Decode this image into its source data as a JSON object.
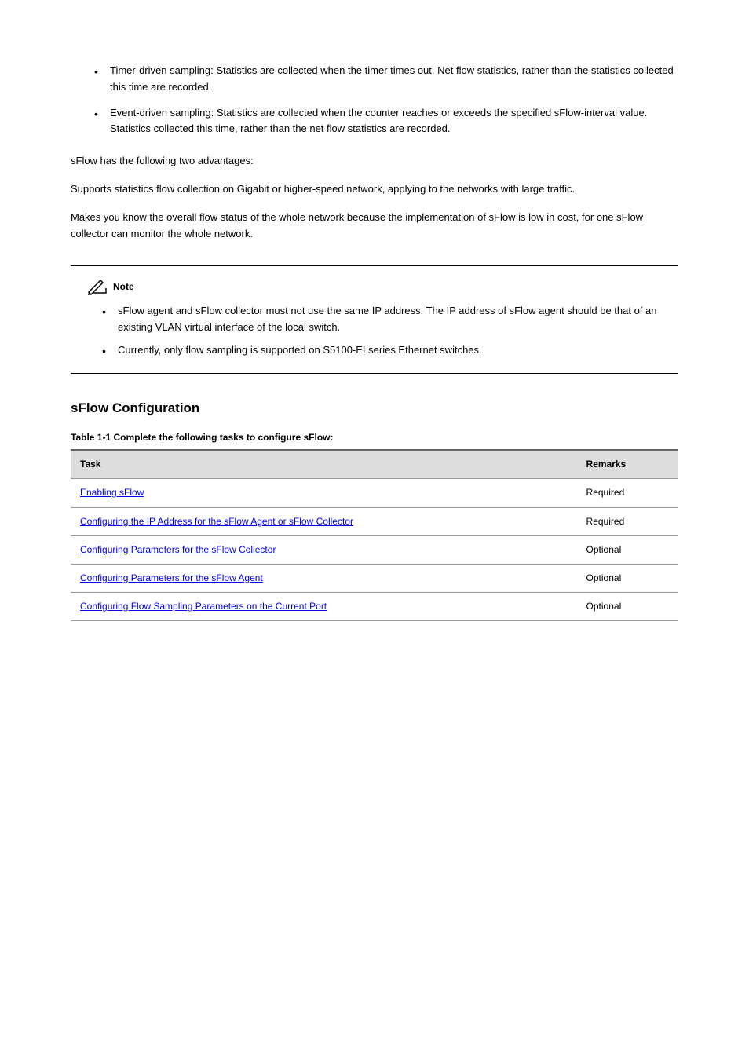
{
  "list1": {
    "item1": "Timer-driven sampling: Statistics are collected when the timer times out. Net flow statistics, rather than the statistics collected this time are recorded.",
    "item2": "Event-driven sampling: Statistics are collected when the counter reaches or exceeds the specified sFlow-interval value. Statistics collected this time, rather than the net flow statistics are recorded."
  },
  "para1": "sFlow has the following two advantages:",
  "para2": "Supports statistics flow collection on Gigabit or higher-speed network, applying to the networks with large traffic.",
  "para3": "Makes you know the overall flow status of the whole network because the implementation of sFlow is low in cost, for one sFlow collector can monitor the whole network.",
  "note": {
    "label": "Note",
    "item1": "sFlow agent and sFlow collector must not use the same IP address. The IP address of sFlow agent should be that of an existing VLAN virtual interface of the local switch.",
    "item2": "Currently, only flow sampling is supported on S5100-EI series Ethernet switches."
  },
  "sectionTitle": "sFlow Configuration",
  "tableTitle": "Table 1-1 Complete the following tasks to configure sFlow:",
  "table": {
    "headers": [
      "Task",
      "Remarks"
    ],
    "rows": [
      {
        "task": "Enabling sFlow",
        "remarks": "Required"
      },
      {
        "task": "Configuring the IP Address for the sFlow Agent or sFlow Collector",
        "remarks": "Required"
      },
      {
        "task": "Configuring Parameters for the sFlow Collector",
        "remarks": "Optional"
      },
      {
        "task": "Configuring Parameters for the sFlow Agent",
        "remarks": "Optional"
      },
      {
        "task": "Configuring Flow Sampling Parameters on the Current Port",
        "remarks": "Optional"
      }
    ]
  }
}
